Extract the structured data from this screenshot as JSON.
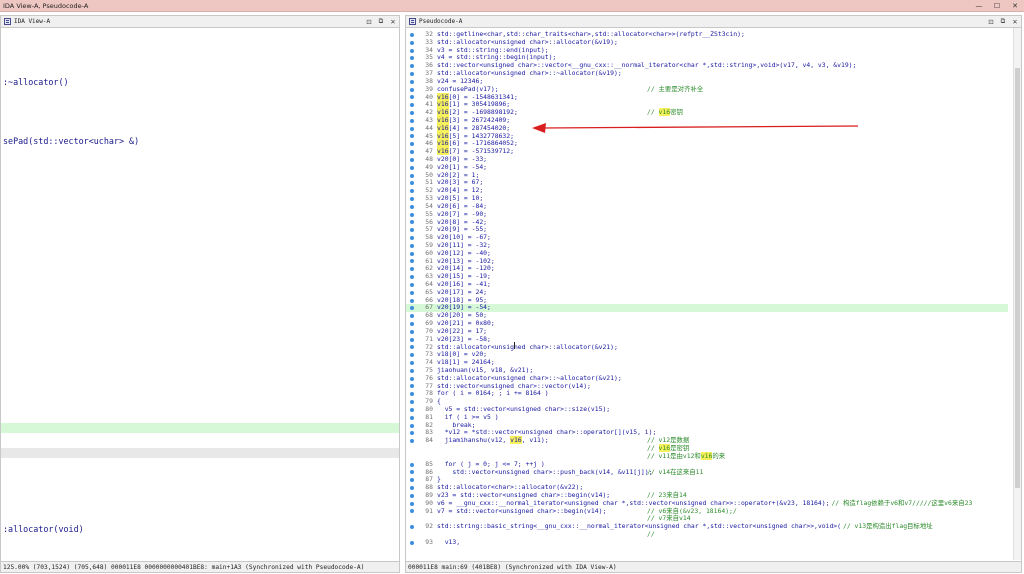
{
  "window": {
    "title": "IDA View-A, Pseudocode-A"
  },
  "left_pane": {
    "tab_label": "IDA View-A",
    "fragments": [
      {
        "text": ":~allocator()"
      },
      {
        "text": "sePad(std::vector<uchar> &)"
      },
      {
        "text": ":allocator(void)"
      }
    ],
    "status": "125.00% (703,1524) (705,648) 000011E8 0000000000401BE8: main+1A3 (Synchronized with Pseudocode-A)"
  },
  "right_pane": {
    "tab_label": "Pseudocode-A",
    "status": "000011E8 main:69 (401BE8) (Synchronized with IDA View-A)",
    "lines": [
      {
        "n": "32",
        "t": "std::getline<char,std::char_traits<char>,std::allocator<char>>(refptr__ZSt3cin);",
        "c": ""
      },
      {
        "n": "33",
        "t": "std::allocator<unsigned char>::allocator(&v19);",
        "c": ""
      },
      {
        "n": "34",
        "t": "v3 = std::string::end(input);",
        "c": ""
      },
      {
        "n": "35",
        "t": "v4 = std::string::begin(input);",
        "c": ""
      },
      {
        "n": "36",
        "t": "std::vector<unsigned char>::vector<__gnu_cxx::__normal_iterator<char *,std::string>,void>(v17, v4, v3, &v19);",
        "c": ""
      },
      {
        "n": "37",
        "t": "std::allocator<unsigned char>::~allocator(&v19);",
        "c": ""
      },
      {
        "n": "38",
        "t": "v24 = 12346;",
        "c": ""
      },
      {
        "n": "39",
        "t": "confusePad(v17);",
        "c": "// 主要是对齐补全"
      },
      {
        "n": "40",
        "t": "v16[0] = -1548631341;",
        "c": ""
      },
      {
        "n": "41",
        "t": "v16[1] = 305419896;",
        "c": ""
      },
      {
        "n": "42",
        "t": "v16[2] = -1698898192;",
        "c": "// v16密钥"
      },
      {
        "n": "43",
        "t": "v16[3] = 267242409;",
        "c": ""
      },
      {
        "n": "44",
        "t": "v16[4] = 287454020;",
        "c": ""
      },
      {
        "n": "45",
        "t": "v16[5] = 1432778632;",
        "c": ""
      },
      {
        "n": "46",
        "t": "v16[6] = -1716864052;",
        "c": ""
      },
      {
        "n": "47",
        "t": "v16[7] = -571539712;",
        "c": ""
      },
      {
        "n": "48",
        "t": "v20[0] = -33;",
        "c": ""
      },
      {
        "n": "49",
        "t": "v20[1] = -54;",
        "c": ""
      },
      {
        "n": "50",
        "t": "v20[2] = 1;",
        "c": ""
      },
      {
        "n": "51",
        "t": "v20[3] = 67;",
        "c": ""
      },
      {
        "n": "52",
        "t": "v20[4] = 12;",
        "c": ""
      },
      {
        "n": "53",
        "t": "v20[5] = 10;",
        "c": ""
      },
      {
        "n": "54",
        "t": "v20[6] = -84;",
        "c": ""
      },
      {
        "n": "55",
        "t": "v20[7] = -90;",
        "c": ""
      },
      {
        "n": "56",
        "t": "v20[8] = -42;",
        "c": ""
      },
      {
        "n": "57",
        "t": "v20[9] = -55;",
        "c": ""
      },
      {
        "n": "58",
        "t": "v20[10] = -67;",
        "c": ""
      },
      {
        "n": "59",
        "t": "v20[11] = -32;",
        "c": ""
      },
      {
        "n": "60",
        "t": "v20[12] = -40;",
        "c": ""
      },
      {
        "n": "61",
        "t": "v20[13] = -102;",
        "c": ""
      },
      {
        "n": "62",
        "t": "v20[14] = -120;",
        "c": ""
      },
      {
        "n": "63",
        "t": "v20[15] = -19;",
        "c": ""
      },
      {
        "n": "64",
        "t": "v20[16] = -41;",
        "c": ""
      },
      {
        "n": "65",
        "t": "v20[17] = 24;",
        "c": ""
      },
      {
        "n": "66",
        "t": "v20[18] = 95;",
        "c": ""
      },
      {
        "n": "67",
        "t": "v20[19] = -54;",
        "c": ""
      },
      {
        "n": "68",
        "t": "v20[20] = 50;",
        "c": ""
      },
      {
        "n": "69",
        "t": "v20[21] = 0x80;",
        "c": ""
      },
      {
        "n": "70",
        "t": "v20[22] = 17;",
        "c": ""
      },
      {
        "n": "71",
        "t": "v20[23] = -58;",
        "c": ""
      },
      {
        "n": "72",
        "t": "std::allocator<unsigned char>::allocator(&v21);",
        "c": ""
      },
      {
        "n": "73",
        "t": "v18[0] = v20;",
        "c": ""
      },
      {
        "n": "74",
        "t": "v18[1] = 24164;",
        "c": ""
      },
      {
        "n": "75",
        "t": "jiaohuan(v15, v18, &v21);",
        "c": ""
      },
      {
        "n": "76",
        "t": "std::allocator<unsigned char>::~allocator(&v21);",
        "c": ""
      },
      {
        "n": "77",
        "t": "std::vector<unsigned char>::vector(v14);",
        "c": ""
      },
      {
        "n": "78",
        "t": "for ( i = 0164; ; i += 8164 )",
        "c": ""
      },
      {
        "n": "79",
        "t": "{",
        "c": ""
      },
      {
        "n": "80",
        "t": "  v5 = std::vector<unsigned char>::size(v15);",
        "c": ""
      },
      {
        "n": "81",
        "t": "  if ( i >= v5 )",
        "c": ""
      },
      {
        "n": "82",
        "t": "    break;",
        "c": ""
      },
      {
        "n": "83",
        "t": "  *v12 = *std::vector<unsigned char>::operator[](v15, i);",
        "c": ""
      },
      {
        "n": "84",
        "t": "  jiamihanshu(v12, v16, v11);",
        "c": "// v12是数据"
      },
      {
        "n": "",
        "t": "",
        "c": "// v16是密钥"
      },
      {
        "n": "",
        "t": "",
        "c": "// v11是由v12和v16的来"
      },
      {
        "n": "85",
        "t": "  for ( j = 0; j <= 7; ++j )",
        "c": ""
      },
      {
        "n": "86",
        "t": "    std::vector<unsigned char>::push_back(v14, &v11[j]);",
        "c": "// v14在这来自11"
      },
      {
        "n": "87",
        "t": "}",
        "c": ""
      },
      {
        "n": "88",
        "t": "std::allocator<char>::allocator(&v22);",
        "c": ""
      },
      {
        "n": "89",
        "t": "v23 = std::vector<unsigned char>::begin(v14);",
        "c": "// 23来自14"
      },
      {
        "n": "90",
        "t": "v6 = __gnu_cxx::__normal_iterator<unsigned char *,std::vector<unsigned char>>::operator+(&v23, 18164);",
        "c": "// 构造flag依赖于v6和v7/////这里v6来自23"
      },
      {
        "n": "91",
        "t": "v7 = std::vector<unsigned char>::begin(v14);",
        "c": "// v6来自(&v23, 18164);/"
      },
      {
        "n": "",
        "t": "",
        "c": "// v7来自v14"
      },
      {
        "n": "92",
        "t": "std::string::basic_string<__gnu_cxx::__normal_iterator<unsigned char *,std::vector<unsigned char>>,void>(",
        "c": "// v13是构造出flag目标地址"
      },
      {
        "n": "",
        "t": "",
        "c": "//"
      },
      {
        "n": "93",
        "t": "  v13,",
        "c": ""
      }
    ]
  }
}
